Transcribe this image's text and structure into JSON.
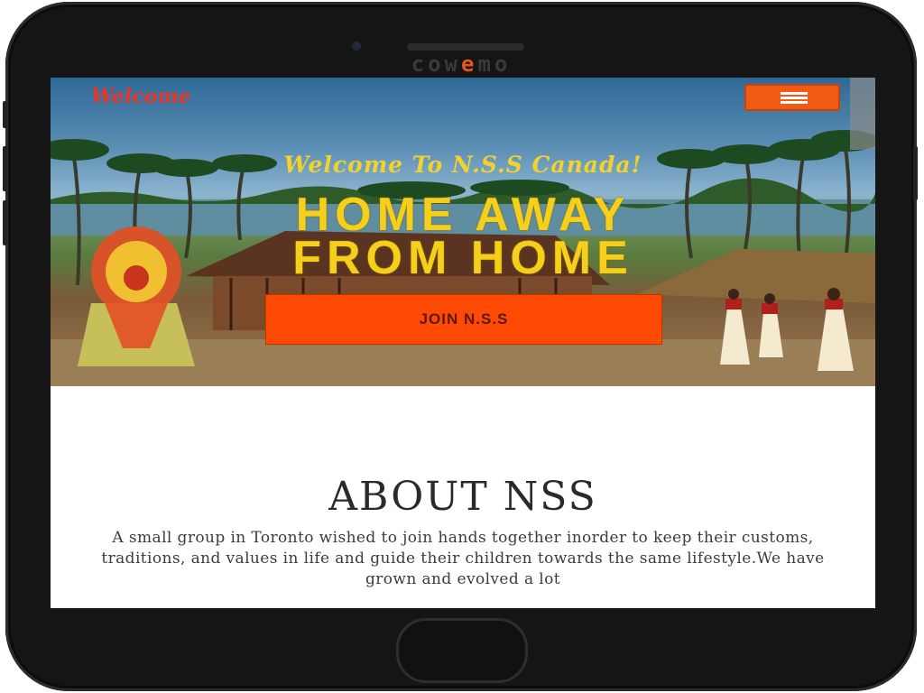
{
  "device": {
    "brand_prefix": "cow",
    "brand_highlight": "e",
    "brand_suffix": "mo"
  },
  "header": {
    "logo_text": "Welcome",
    "menu_icon": "hamburger-menu-icon"
  },
  "hero": {
    "tagline": "Welcome To N.S.S Canada!",
    "headline_line1": "HOME AWAY",
    "headline_line2": "FROM HOME",
    "join_button_label": "JOIN N.S.S"
  },
  "about": {
    "title": "ABOUT NSS",
    "body": "A small group in Toronto wished to join hands together inorder to keep their customs, traditions, and values in life and guide their children towards the same lifestyle.We have grown and evolved a lot"
  },
  "colors": {
    "accent": "#f05a12",
    "headline": "#f5cf1a",
    "logo": "#e8352a"
  }
}
